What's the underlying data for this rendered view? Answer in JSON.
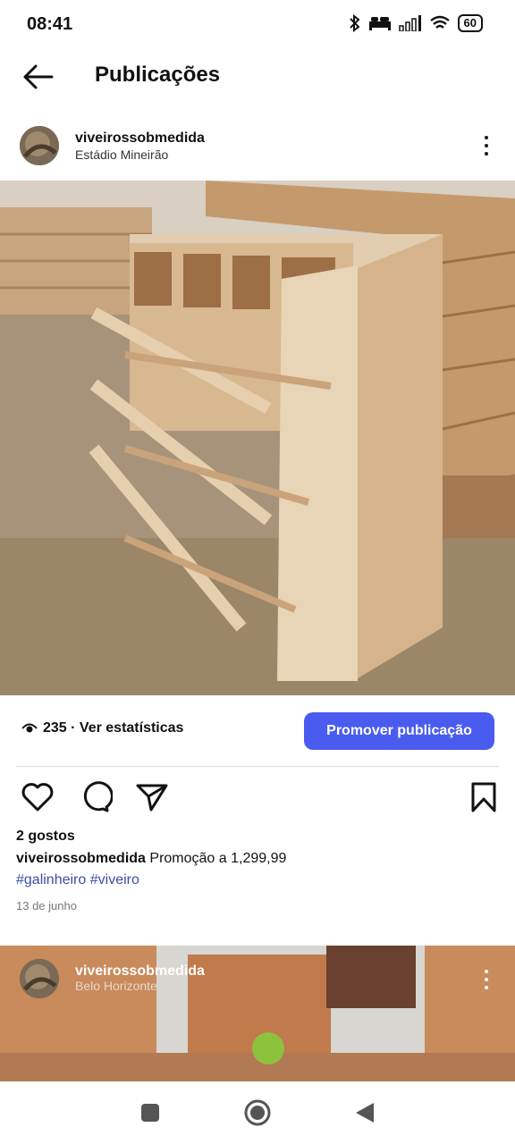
{
  "status_bar": {
    "time": "08:41",
    "battery": "60"
  },
  "header": {
    "title": "Publicações"
  },
  "post": {
    "username": "viveirossobmedida",
    "location": "Estádio Mineirão",
    "views": "235 · Ver estatísticas",
    "promote_label": "Promover publicação",
    "likes": "2 gostos",
    "caption_user": "viveirossobmedida",
    "caption_text": " Promoção a 1,299,99",
    "tags": [
      "#galinheiro",
      "#viveiro"
    ],
    "date": "13 de junho"
  },
  "next_post": {
    "username": "viveirossobmedida",
    "location": "Belo Horizonte"
  },
  "colors": {
    "accent": "#4a5cf0",
    "hashtag": "#3b4ea8"
  },
  "icons": [
    "back-arrow-icon",
    "more-options-icon",
    "eye-icon",
    "heart-icon",
    "comment-icon",
    "share-icon",
    "bookmark-icon",
    "nav-recents-icon",
    "nav-home-icon",
    "nav-back-icon"
  ]
}
